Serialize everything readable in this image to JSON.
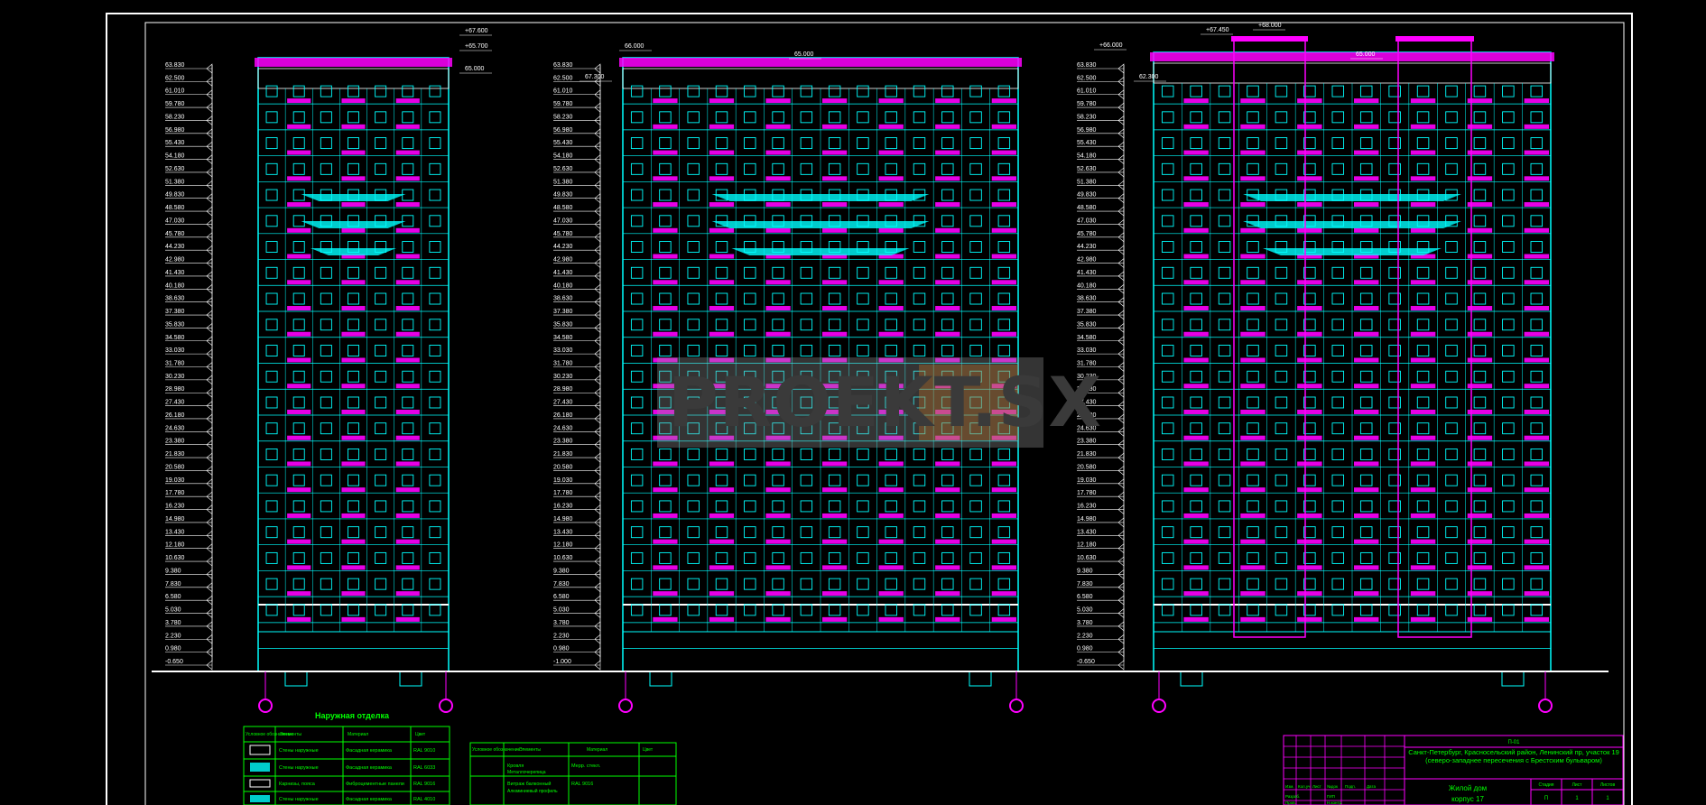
{
  "drawing": {
    "colors": {
      "frame": "#ffffff",
      "wall": "#00ffff",
      "balcony": "#ff00ff",
      "text": "#ffffff",
      "table": "#00ff00",
      "marker": "#ff00ff",
      "ground": "#ffffff"
    },
    "elevation_levels": [
      "63.830",
      "62.500",
      "61.010",
      "59.780",
      "58.230",
      "56.980",
      "55.430",
      "54.180",
      "52.630",
      "51.380",
      "49.830",
      "48.580",
      "47.030",
      "45.780",
      "44.230",
      "42.980",
      "41.430",
      "40.180",
      "38.630",
      "37.380",
      "35.830",
      "34.580",
      "33.030",
      "31.780",
      "30.230",
      "28.980",
      "27.430",
      "26.180",
      "24.630",
      "23.380",
      "21.830",
      "20.580",
      "19.030",
      "17.780",
      "16.230",
      "14.980",
      "13.430",
      "12.180",
      "10.630",
      "9.380",
      "7.830",
      "6.580",
      "5.030",
      "3.780",
      "2.230",
      "0.980",
      "-0.650"
    ],
    "side_elevation": {
      "top_marks": [
        "+67.600",
        "+65.700",
        "65.000"
      ]
    },
    "main_elevation": {
      "top_marks": [
        "66.000",
        "65.000",
        "67.300"
      ],
      "bottom_level": "-1.000"
    },
    "rear_elevation": {
      "top_marks": [
        "+67.450",
        "+68.000",
        "+66.000",
        "65.000",
        "62.300"
      ]
    }
  },
  "legend": {
    "title": "Наружная отделка",
    "header": [
      "Условное обозначение",
      "Элементы",
      "Материал",
      "Цвет"
    ],
    "rows": [
      [
        "Стены наружные",
        "Фасадная керамика",
        "RAL 9010"
      ],
      [
        "Стены наружные",
        "Фасадная керамика",
        "RAL 6033"
      ],
      [
        "Карнизы, пояса",
        "Фиброцементные панели",
        "RAL 9016"
      ],
      [
        "Стены наружные",
        "Фасадная керамика",
        "RAL 4010"
      ]
    ]
  },
  "legend2": {
    "header": [
      "Условное обозначение",
      "Элементы",
      "Материал",
      "Цвет"
    ],
    "rows": [
      [
        "Кровля",
        "Металлочерепица",
        "Мерр. стекл."
      ],
      [
        "Витраж балконный",
        "Алюминиевый профиль",
        "RAL 9016"
      ]
    ]
  },
  "stamp": {
    "code": "П-01",
    "address": "Санкт-Петербург, Красносельский район, Ленинский пр, участок 19 (северо-западнее пересечения с Брестским бульваром)",
    "object": "Жилой дом",
    "building": "корпус 17",
    "headers": [
      "Изм.",
      "Кол.уч",
      "Лист",
      "№док",
      "Подп.",
      "Дата"
    ],
    "sheet_labels": [
      "Стадия",
      "Лист",
      "Листов"
    ],
    "sheet_values": [
      "П",
      "1",
      "1"
    ],
    "roles": [
      "Разраб.",
      "Пров.",
      "ГИП",
      "Н.контр."
    ]
  },
  "watermark": {
    "text": "PROEKT.SX"
  }
}
